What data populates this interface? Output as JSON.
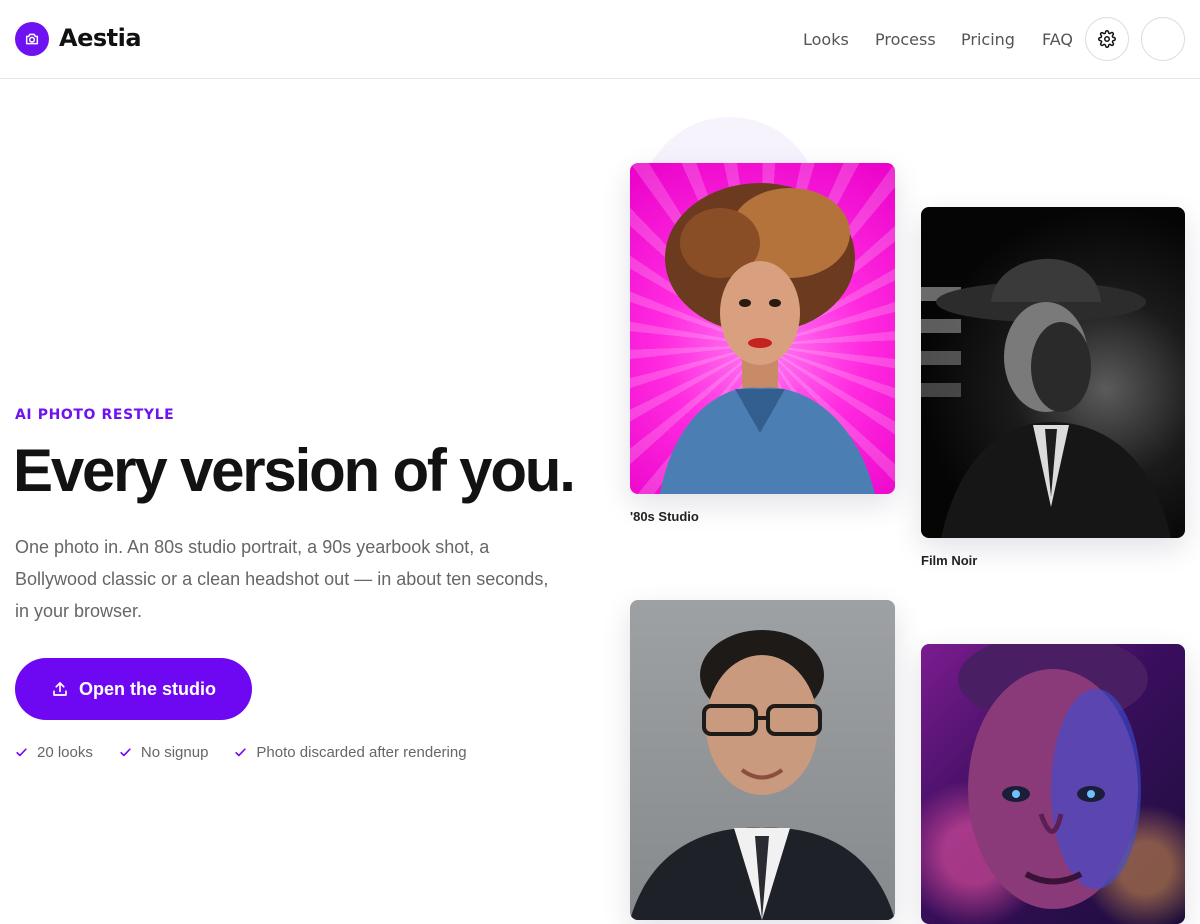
{
  "header": {
    "brand": "Aestia",
    "nav": [
      "Looks",
      "Process",
      "Pricing",
      "FAQ"
    ],
    "icons": {
      "logo": "camera-icon",
      "settings": "gear-icon"
    }
  },
  "hero": {
    "eyebrow": "AI PHOTO RESTYLE",
    "headline": "Every version of you.",
    "subtext": "One photo in. An 80s studio portrait, a 90s yearbook shot, a Bollywood classic or a clean headshot out — in about ten seconds, in your browser.",
    "cta_label": "Open the studio",
    "cta_icon": "upload-icon",
    "checks": [
      "20 looks",
      "No signup",
      "Photo discarded after rendering"
    ]
  },
  "gallery": {
    "cards": [
      {
        "label": "'80s Studio"
      },
      {
        "label": "Film Noir"
      },
      {
        "label": ""
      },
      {
        "label": ""
      }
    ]
  },
  "colors": {
    "accent": "#6f08f2",
    "text": "#121212",
    "muted": "#666666"
  }
}
